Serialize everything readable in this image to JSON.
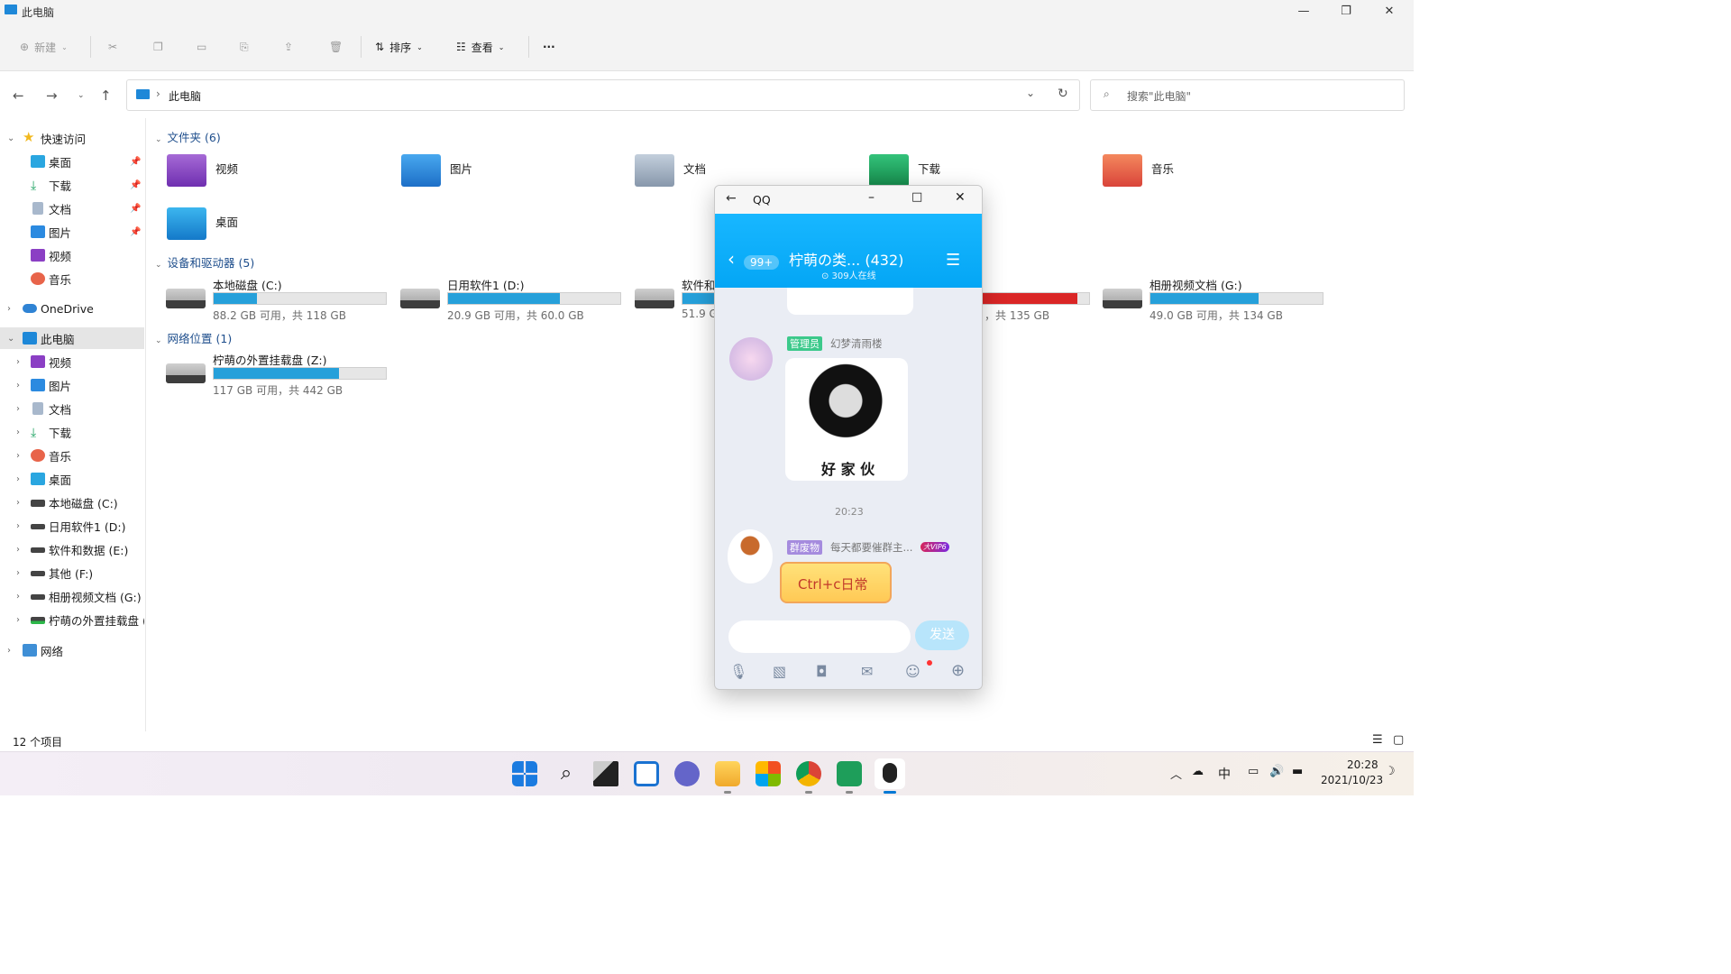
{
  "window": {
    "title": "此电脑",
    "min": "—",
    "max": "❐",
    "close": "✕"
  },
  "toolbar": {
    "new": "新建",
    "sort": "排序",
    "view": "查看",
    "more": "···"
  },
  "address": {
    "path": "此电脑",
    "sep": "›",
    "search_placeholder": "搜索\"此电脑\""
  },
  "sidebar": {
    "quick_access": "快速访问",
    "quick_items": [
      "桌面",
      "下载",
      "文档",
      "图片",
      "视频",
      "音乐"
    ],
    "onedrive": "OneDrive",
    "this_pc": "此电脑",
    "pc_items": [
      "视频",
      "图片",
      "文档",
      "下载",
      "音乐",
      "桌面",
      "本地磁盘 (C:)",
      "日用软件1 (D:)",
      "软件和数据 (E:)",
      "其他 (F:)",
      "相册视频文档 (G:)",
      "柠萌の外置挂载盘 ("
    ],
    "network": "网络"
  },
  "folders_group": "文件夹 (6)",
  "folders": [
    "视频",
    "图片",
    "文档",
    "下载",
    "音乐",
    "桌面"
  ],
  "drives_group": "设备和驱动器 (5)",
  "drives": [
    {
      "name": "本地磁盘 (C:)",
      "free": "88.2 GB 可用，共 118 GB",
      "used": 0.25
    },
    {
      "name": "日用软件1 (D:)",
      "free": "20.9 GB 可用，共 60.0 GB",
      "used": 0.65
    },
    {
      "name": "软件和",
      "free": "51.9 G",
      "used": 0.5
    },
    {
      "name": "",
      "free": "，共 135 GB",
      "used": 0.93
    },
    {
      "name": "相册视频文档 (G:)",
      "free": "49.0 GB 可用，共 134 GB",
      "used": 0.63
    }
  ],
  "network_group": "网络位置 (1)",
  "netdrive": {
    "name": "柠萌の外置挂载盘 (Z:)",
    "free": "117 GB 可用，共 442 GB",
    "used": 0.73
  },
  "status": {
    "count": "12 个项目"
  },
  "qq": {
    "title": "QQ",
    "badge": "99+",
    "group_name": "柠萌の类... (432)",
    "online": "⊙ 309人在线",
    "msg1": {
      "role": "管理员",
      "name": "幻梦清雨楼",
      "sticker_text": "好 家 伙"
    },
    "time": "20:23",
    "msg2": {
      "role": "群废物",
      "name": "每天都要催群主...",
      "vip": "大VIP6",
      "bubble": "Ctrl+c日常"
    },
    "send": "发送"
  },
  "tray": {
    "ime": "中",
    "time": "20:28",
    "date": "2021/10/23"
  },
  "colors": {
    "accent": "#26a0da",
    "full": "#da2626",
    "qq_blue": "#0aaef9"
  }
}
